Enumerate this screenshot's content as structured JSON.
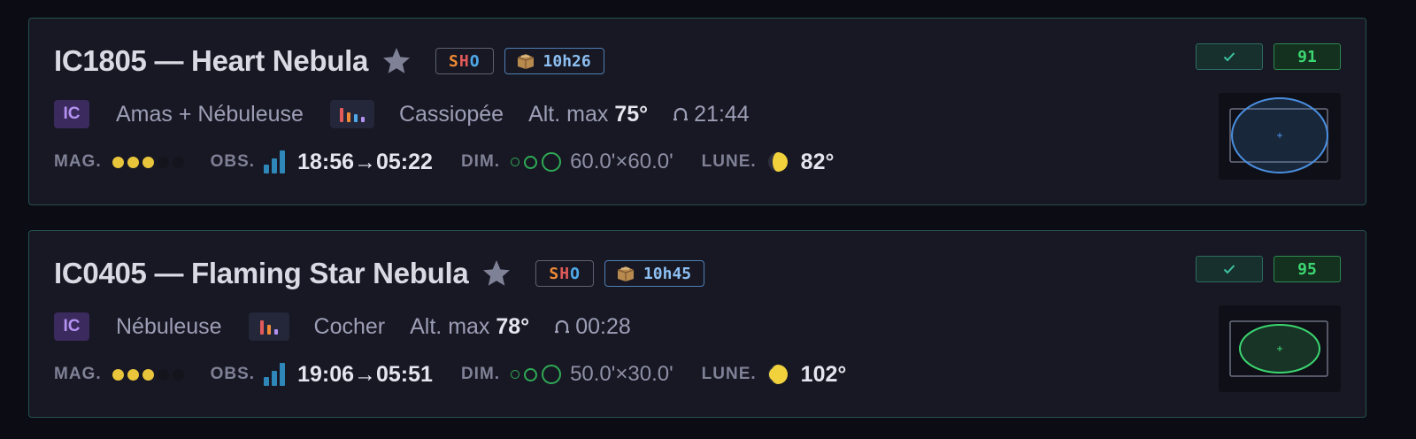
{
  "targets": [
    {
      "title": "IC1805 — Heart Nebula",
      "filter": {
        "s": "S",
        "h": "H",
        "o": "O"
      },
      "duration": "10h26",
      "catalog": "IC",
      "type": "Amas + Nébuleuse",
      "constellation": "Cassiopée",
      "alt_label": "Alt. max",
      "alt_value": "75°",
      "transit": "21:44",
      "mag_label": "MAG.",
      "mag_level": 3,
      "mag_max": 5,
      "obs_label": "OBS.",
      "obs_window": "18:56→05:22",
      "dim_label": "DIM.",
      "dimensions": "60.0'×60.0'",
      "moon_label": "LUNE.",
      "moon_separation": "82°",
      "score": "91",
      "fov_color": "#4a8fe0"
    },
    {
      "title": "IC0405 — Flaming Star Nebula",
      "filter": {
        "s": "S",
        "h": "H",
        "o": "O"
      },
      "duration": "10h45",
      "catalog": "IC",
      "type": "Nébuleuse",
      "constellation": "Cocher",
      "alt_label": "Alt. max",
      "alt_value": "78°",
      "transit": "00:28",
      "mag_label": "MAG.",
      "mag_level": 3,
      "mag_max": 5,
      "obs_label": "OBS.",
      "obs_window": "19:06→05:51",
      "dim_label": "DIM.",
      "dimensions": "50.0'×30.0'",
      "moon_label": "LUNE.",
      "moon_separation": "102°",
      "score": "95",
      "fov_color": "#3cd670"
    }
  ],
  "colors": {
    "card_border": "#25514e",
    "score_green": "#3cd670",
    "star": "#7f8196",
    "mag_dot": "#e9c53c",
    "obs_bar": "#2f87b9"
  },
  "icons": {
    "favorite": "star-icon",
    "duration": "box-icon",
    "transit": "transit-icon",
    "moon": "moon-icon",
    "check": "check-icon"
  }
}
